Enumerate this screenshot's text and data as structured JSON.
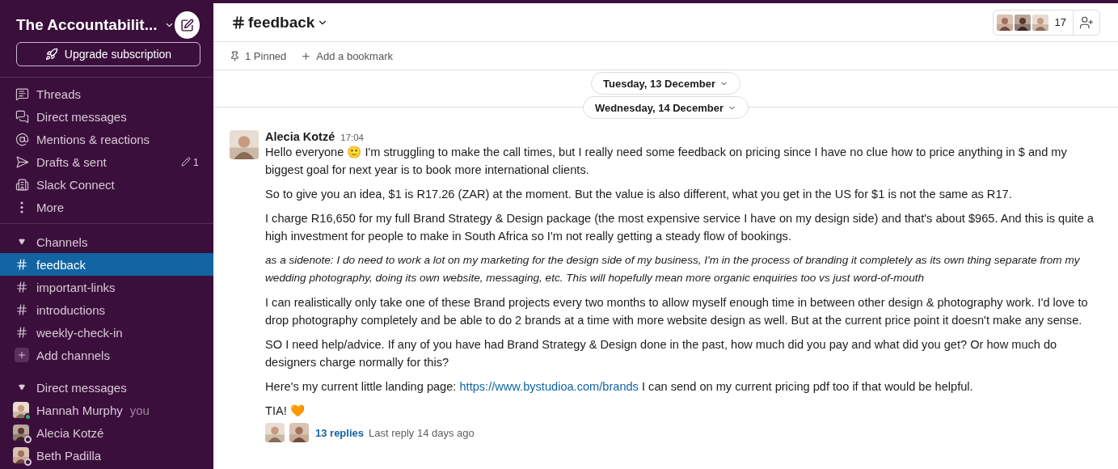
{
  "workspace": {
    "name": "The Accountabilit...",
    "upgrade": "Upgrade subscription"
  },
  "nav": [
    {
      "kind": "threads",
      "label": "Threads"
    },
    {
      "kind": "dms",
      "label": "Direct messages"
    },
    {
      "kind": "mentions",
      "label": "Mentions & reactions"
    },
    {
      "kind": "drafts",
      "label": "Drafts & sent",
      "count": "1"
    },
    {
      "kind": "connect",
      "label": "Slack Connect"
    },
    {
      "kind": "more",
      "label": "More"
    }
  ],
  "channels": {
    "title": "Channels",
    "expanded": true,
    "items": [
      {
        "name": "feedback",
        "selected": true
      },
      {
        "name": "important-links",
        "selected": false
      },
      {
        "name": "introductions",
        "selected": false
      },
      {
        "name": "weekly-check-in",
        "selected": false
      }
    ],
    "add": "Add channels"
  },
  "direct_messages": {
    "title": "Direct messages",
    "expanded": true,
    "items": [
      {
        "name": "Hannah Murphy",
        "suffix": "you",
        "online": true
      },
      {
        "name": "Alecia Kotzé",
        "online": false
      },
      {
        "name": "Beth Padilla",
        "online": false
      }
    ]
  },
  "header": {
    "channel": "feedback",
    "member_count": "17"
  },
  "bookmarks": {
    "pinned": "1 Pinned",
    "add": "Add a bookmark"
  },
  "date_dividers": [
    "Tuesday, 13 December",
    "Wednesday, 14 December"
  ],
  "message": {
    "author": "Alecia Kotzé",
    "time": "17:04",
    "paragraphs": [
      {
        "kind": "text",
        "text": "Hello everyone 🙂 I'm struggling to make the call times, but I really need some feedback on pricing since I have no clue how to price anything in $ and my biggest goal for next year is to book more international clients."
      },
      {
        "kind": "text",
        "text": "So to give you an idea, $1 is R17.26 (ZAR) at the moment. But the value is also different, what you get in the US for $1 is not the same as R17."
      },
      {
        "kind": "text",
        "text": "I charge R16,650 for my full Brand Strategy & Design package (the most expensive service I have on my design side) and that's about $965. And this is quite a high investment for people to make in South Africa so I'm not really getting a steady flow of bookings."
      },
      {
        "kind": "aside",
        "text": "as a sidenote: I do need to work a lot on my marketing for the design side of my business, I'm in the process of branding it completely as its own thing separate from my wedding photography, doing its own website, messaging, etc. This will hopefully mean more organic enquiries too vs just word-of-mouth"
      },
      {
        "kind": "text",
        "text": "I can realistically only take one of these Brand projects every two months to allow myself enough time in between other design & photography work. I'd love to drop photography completely and be able to do 2 brands at a time with more website design as well. But at the current price point it doesn't make any sense."
      },
      {
        "kind": "text",
        "text": "SO I need help/advice. If any of you have had Brand Strategy & Design done in the past, how much did you pay and what did you get? Or how much do designers charge normally for this?"
      },
      {
        "kind": "text",
        "text": "Here's my current little landing page:",
        "link": "https://www.bystudioa.com/brands",
        "tail": "I can send on my current pricing pdf too if that would be helpful."
      },
      {
        "kind": "text",
        "text": "TIA! 🧡"
      }
    ],
    "thread": {
      "replies": "13 replies",
      "last_reply": "Last reply 14 days ago"
    }
  }
}
